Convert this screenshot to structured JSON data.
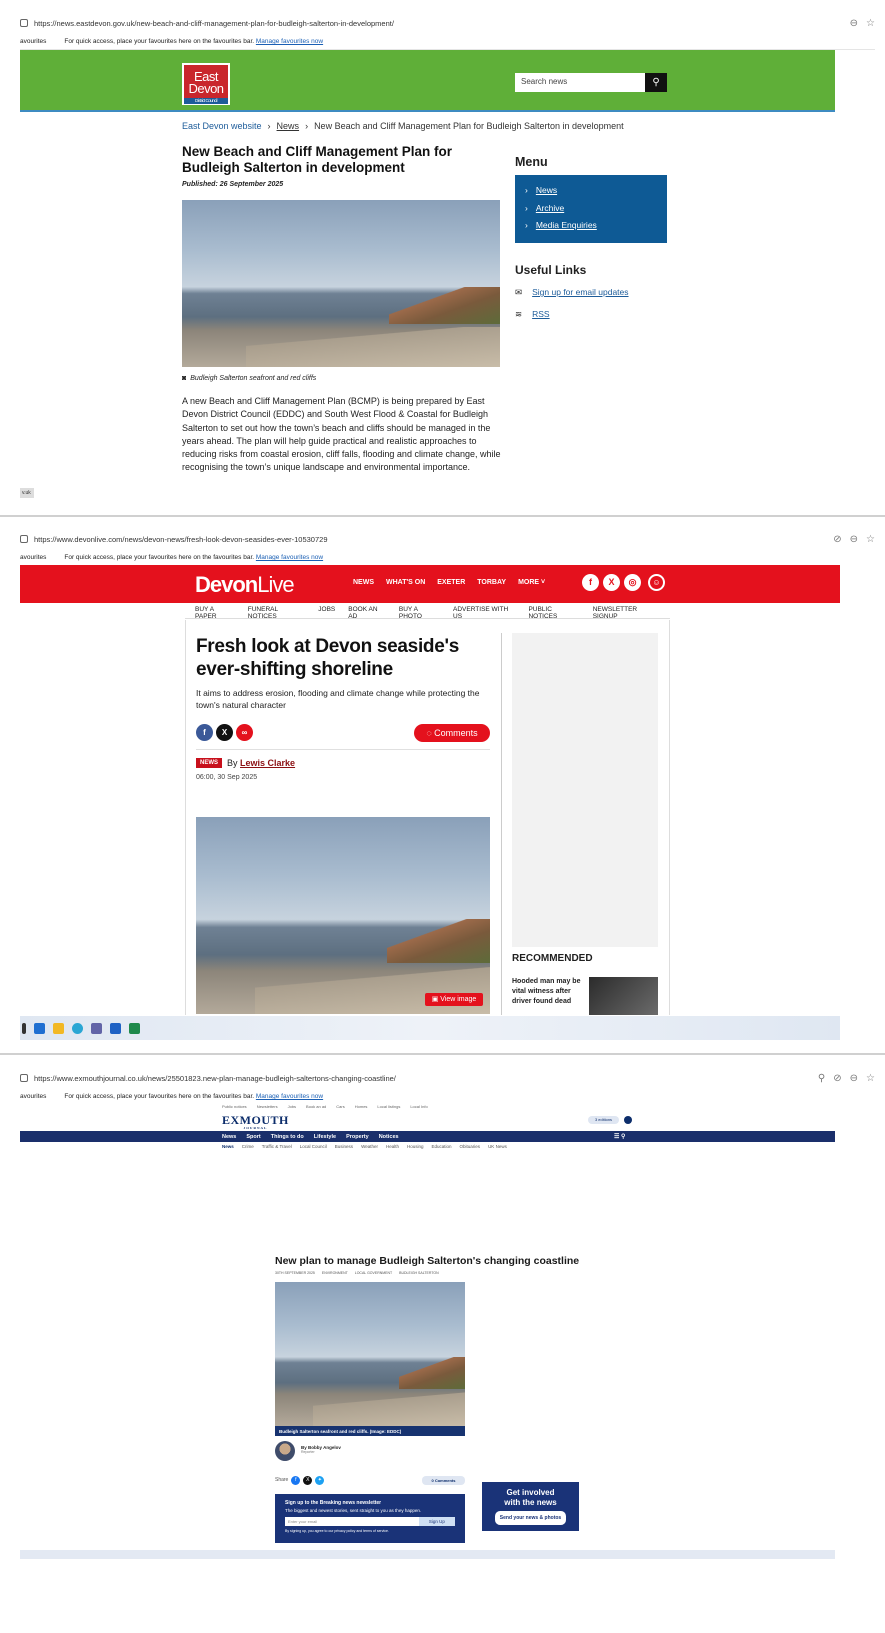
{
  "shot1": {
    "url": "https://news.eastdevon.gov.uk/new-beach-and-cliff-management-plan-for-budleigh-salterton-in-development/",
    "favs_left": "avourites",
    "favs_msg": "For quick access, place your favourites here on the favourites bar.",
    "favs_link": "Manage favourites now",
    "logo_line1": "East",
    "logo_line2": "Devon",
    "logo_sub": "District Council",
    "search_placeholder": "Search news",
    "breadcrumb": [
      "East Devon website",
      "News",
      "New Beach and Cliff Management Plan for Budleigh Salterton in development"
    ],
    "title": "New Beach and Cliff Management Plan for Budleigh Salterton in development",
    "published": "Published: 26 September 2025",
    "caption": "Budleigh Salterton seafront and red cliffs",
    "body": "A new Beach and Cliff Management Plan (BCMP) is being prepared by East Devon District Council (EDDC) and South West Flood & Coastal for Budleigh Salterton to set out how the town’s beach and cliffs should be managed in the years ahead. The plan will help guide practical and realistic approaches to reducing risks from coastal erosion, cliff falls, flooding and climate change, while recognising the town’s unique landscape and environmental importance.",
    "menu_title": "Menu",
    "menu_items": [
      "News",
      "Archive",
      "Media Enquiries"
    ],
    "useful_title": "Useful Links",
    "useful_items": [
      "Sign up for email updates",
      "RSS"
    ],
    "foot_tag": "v.uk"
  },
  "shot2": {
    "url": "https://www.devonlive.com/news/devon-news/fresh-look-devon-seasides-ever-10530729",
    "favs_left": "avourites",
    "favs_msg": "For quick access, place your favourites here on the favourites bar.",
    "favs_link": "Manage favourites now",
    "logo_a": "Devon",
    "logo_b": "Live",
    "nav": [
      "NEWS",
      "WHAT'S ON",
      "EXETER",
      "TORBAY",
      "MORE ˅"
    ],
    "subnav": [
      "BUY A PAPER",
      "FUNERAL NOTICES",
      "JOBS",
      "BOOK AN AD",
      "BUY A PHOTO",
      "ADVERTISE WITH US",
      "PUBLIC NOTICES",
      "NEWSLETTER SIGNUP"
    ],
    "title": "Fresh look at Devon seaside's ever-shifting shoreline",
    "standfirst": "It aims to address erosion, flooding and climate change while protecting the town's natural character",
    "comments": "Comments",
    "tag": "NEWS",
    "by": "By",
    "author": "Lewis Clarke",
    "date": "06:00, 30 Sep 2025",
    "view_image": "View image",
    "recommended": "RECOMMENDED",
    "rec_title": "Hooded man may be vital witness after driver found dead"
  },
  "shot3": {
    "url": "https://www.exmouthjournal.co.uk/news/25501823.new-plan-manage-budleigh-saltertons-changing-coastline/",
    "favs_left": "avourites",
    "favs_msg": "For quick access, place your favourites here on the favourites bar.",
    "favs_link": "Manage favourites now",
    "top_links": [
      "Public notices",
      "Newsletters",
      "Jobs",
      "Book an ad",
      "Cars",
      "Homes",
      "Local listings",
      "Local Info"
    ],
    "logo": "EXMOUTH",
    "logo_sub": "JOURNAL",
    "editions": "3 editions",
    "nav": [
      "News",
      "Sport",
      "Things to do",
      "Lifestyle",
      "Property",
      "Notices"
    ],
    "subnav": [
      "News",
      "Crime",
      "Traffic & Travel",
      "Local Council",
      "Business",
      "Weather",
      "Health",
      "Housing",
      "Education",
      "Obituaries",
      "UK News"
    ],
    "title": "New plan to manage Budleigh Salterton's changing coastline",
    "meta": [
      "30TH SEPTEMBER 2025",
      "ENVIRONMENT",
      "LOCAL GOVERNMENT",
      "BUDLEIGH SALTERTON"
    ],
    "caption": "Budleigh Salterton seafront and red cliffs. (Image: EDDC)",
    "author": "By Bobby Angelov",
    "author_role": "Reporter",
    "share": "Share",
    "comments": "0 Comments",
    "nl_title": "Sign up to the Breaking news newsletter",
    "nl_sub": "The biggest and newest stories, sent straight to you as they happen.",
    "nl_placeholder": "Enter your email",
    "nl_button": "Sign Up",
    "nl_fine": "By signing up, you agree to our privacy policy and terms of service.",
    "gi_line1": "Get involved",
    "gi_line2": "with the news",
    "gi_button": "Send your news & photos"
  }
}
